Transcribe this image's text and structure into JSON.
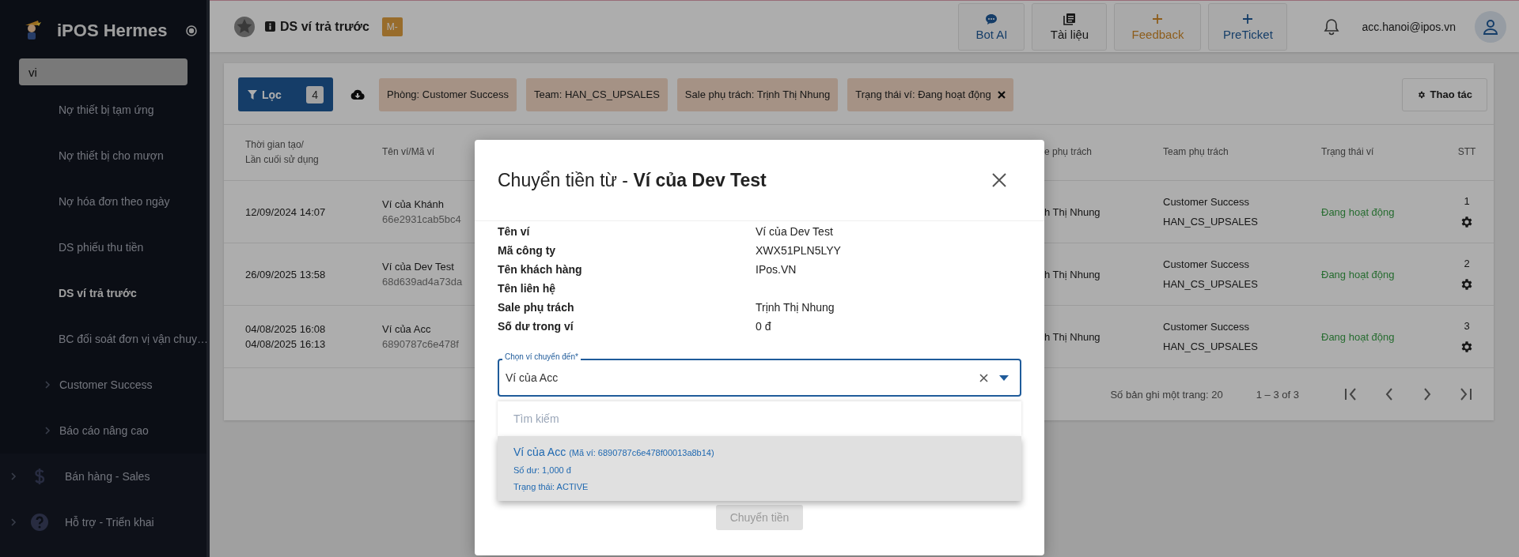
{
  "sidebar": {
    "brand": "iPOS Hermes",
    "search": {
      "value": "vi"
    },
    "items": [
      {
        "kind": "link",
        "label": "Nợ thiết bị tạm ứng",
        "selected": false
      },
      {
        "kind": "link",
        "label": "Nợ thiết bị cho mượn",
        "selected": false
      },
      {
        "kind": "link",
        "label": "Nợ hóa đơn theo ngày",
        "selected": false
      },
      {
        "kind": "link",
        "label": "DS phiếu thu tiền",
        "selected": false
      },
      {
        "kind": "link",
        "label": "DS ví trả trước",
        "selected": true
      },
      {
        "kind": "link",
        "label": "BC đối soát đơn vị vận chuy…",
        "selected": false
      },
      {
        "kind": "group",
        "label": "Customer Success",
        "expanded": false
      },
      {
        "kind": "group",
        "label": "Báo cáo nâng cao",
        "expanded": false
      },
      {
        "kind": "section",
        "label": "Bán hàng - Sales",
        "expanded": false
      },
      {
        "kind": "section",
        "label": "Hỗ trợ - Triển khai",
        "expanded": false
      }
    ]
  },
  "topbar": {
    "title": "DS ví trả trước",
    "badge": "M-",
    "actions": [
      {
        "kind": "chat",
        "label": "Bot AI"
      },
      {
        "kind": "docs",
        "label": "Tài liệu"
      },
      {
        "kind": "feedback",
        "label": "Feedback"
      },
      {
        "kind": "ticket",
        "label": "PreTicket"
      }
    ],
    "user": "acc.hanoi@ipos.vn"
  },
  "filters": {
    "button": {
      "label": "Lọc",
      "count": "4"
    },
    "chips": [
      {
        "label": "Phòng: Customer Success",
        "removable": false
      },
      {
        "label": "Team: HAN_CS_UPSALES",
        "removable": false
      },
      {
        "label": "Sale phụ trách: Trịnh Thị Nhung",
        "removable": false
      },
      {
        "label": "Trạng thái ví: Đang hoạt động",
        "removable": true
      }
    ],
    "actions_button": "Thao tác"
  },
  "table": {
    "columns": [
      "Thời gian tạo/\nLần cuối sử dụng",
      "Tên ví/Mã ví",
      "e phụ trách",
      "Team phụ trách",
      "Trạng thái ví",
      "STT"
    ],
    "rows": [
      {
        "times": [
          "12/09/2024 14:07"
        ],
        "name": "Ví của Khánh",
        "code": "66e2931cab5bc4",
        "sale": "h Thị Nhung",
        "team": [
          "Customer Success",
          "HAN_CS_UPSALES"
        ],
        "status": "Đang hoạt động",
        "stt": "1"
      },
      {
        "times": [
          "26/09/2025 13:58"
        ],
        "name": "Ví của Dev Test",
        "code": "68d639ad4a73da",
        "sale": "h Thị Nhung",
        "team": [
          "Customer Success",
          "HAN_CS_UPSALES"
        ],
        "status": "Đang hoạt động",
        "stt": "2"
      },
      {
        "times": [
          "04/08/2025 16:08",
          "04/08/2025 16:13"
        ],
        "name": "Ví của Acc",
        "code": "6890787c6e478f",
        "sale": "h Thị Nhung",
        "team": [
          "Customer Success",
          "HAN_CS_UPSALES"
        ],
        "status": "Đang hoạt động",
        "stt": "3"
      }
    ],
    "pagination": {
      "page_size": "Số bản ghi một trang: 20",
      "range": "1 – 3 of 3"
    }
  },
  "modal": {
    "title": "Chuyển tiền từ - **Ví của Dev Test**",
    "details": [
      {
        "label": "Tên ví",
        "value": "Ví của Dev Test"
      },
      {
        "label": "Mã công ty",
        "value": "XWX51PLN5LYY"
      },
      {
        "label": "Tên khách hàng",
        "value": "IPos.VN"
      },
      {
        "label": "Tên liên hệ"
      },
      {
        "label": "Sale phụ trách",
        "value": "Trịnh Thị Nhung"
      },
      {
        "label": "Số dư trong ví",
        "value": "0 đ"
      }
    ],
    "field": {
      "label": "Chọn ví chuyển đến*",
      "value": "Ví của Acc"
    },
    "dropdown": {
      "placeholder": "Tìm kiếm",
      "options": [
        {
          "name": "Ví của Acc",
          "code": "(Mã ví: 6890787c6e478f00013a8b14)",
          "balance": "Số dư: 1,000 đ",
          "status": "Trạng thái: ACTIVE",
          "selected": true
        }
      ]
    },
    "submit": {
      "label": "Chuyển tiền",
      "disabled": true
    }
  }
}
